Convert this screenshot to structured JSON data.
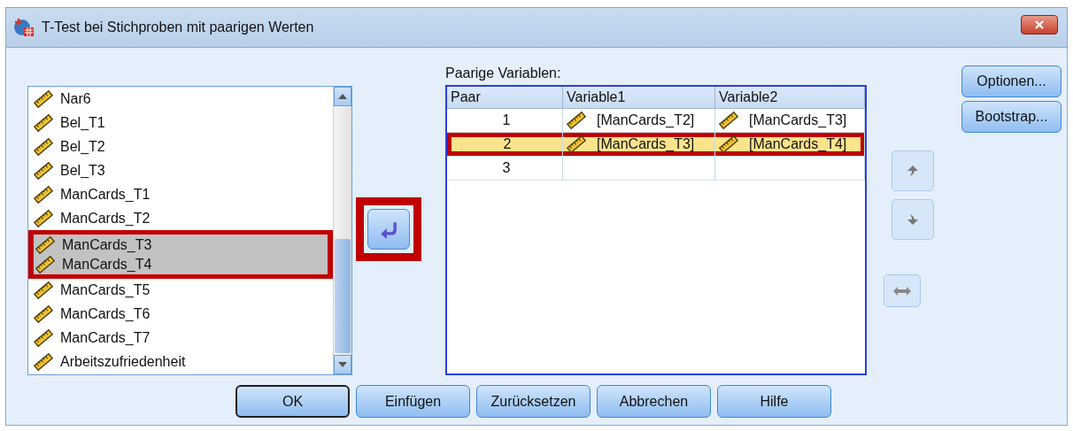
{
  "window": {
    "title": "T-Test bei Stichproben mit paarigen Werten"
  },
  "source_list": {
    "items": [
      {
        "name": "Nar6",
        "kind": "scale",
        "selected": false,
        "highlighted": false
      },
      {
        "name": "Bel_T1",
        "kind": "scale",
        "selected": false,
        "highlighted": false
      },
      {
        "name": "Bel_T2",
        "kind": "scale",
        "selected": false,
        "highlighted": false
      },
      {
        "name": "Bel_T3",
        "kind": "scale",
        "selected": false,
        "highlighted": false
      },
      {
        "name": "ManCards_T1",
        "kind": "scale",
        "selected": false,
        "highlighted": false
      },
      {
        "name": "ManCards_T2",
        "kind": "scale",
        "selected": false,
        "highlighted": false
      },
      {
        "name": "ManCards_T3",
        "kind": "scale",
        "selected": true,
        "highlighted": true
      },
      {
        "name": "ManCards_T4",
        "kind": "scale",
        "selected": true,
        "highlighted": true
      },
      {
        "name": "ManCards_T5",
        "kind": "scale",
        "selected": false,
        "highlighted": false
      },
      {
        "name": "ManCards_T6",
        "kind": "scale",
        "selected": false,
        "highlighted": false
      },
      {
        "name": "ManCards_T7",
        "kind": "scale",
        "selected": false,
        "highlighted": false
      },
      {
        "name": "Arbeitszufriedenheit",
        "kind": "scale",
        "selected": false,
        "highlighted": false
      }
    ]
  },
  "transfer_button": {
    "highlighted": true
  },
  "paired_variables": {
    "label": "Paarige Variablen:",
    "columns": [
      "Paar",
      "Variable1",
      "Variable2"
    ],
    "rows": [
      {
        "pair": "1",
        "variable1": "[ManCards_T2]",
        "variable2": "[ManCards_T3]",
        "selected": false,
        "highlighted": false
      },
      {
        "pair": "2",
        "variable1": "[ManCards_T3]",
        "variable2": "[ManCards_T4]",
        "selected": true,
        "highlighted": true
      },
      {
        "pair": "3",
        "selected": false,
        "highlighted": false
      }
    ]
  },
  "move_buttons": [
    {
      "kind": "up"
    },
    {
      "kind": "down"
    },
    {
      "kind": "swap"
    }
  ],
  "side_buttons": [
    {
      "label": "Optionen..."
    },
    {
      "label": "Bootstrap..."
    }
  ],
  "buttons": [
    {
      "label": "OK",
      "default": true
    },
    {
      "label": "Einfügen",
      "default": false
    },
    {
      "label": "Zurücksetzen",
      "default": false
    },
    {
      "label": "Abbrechen",
      "default": false
    },
    {
      "label": "Hilfe",
      "default": false
    }
  ]
}
